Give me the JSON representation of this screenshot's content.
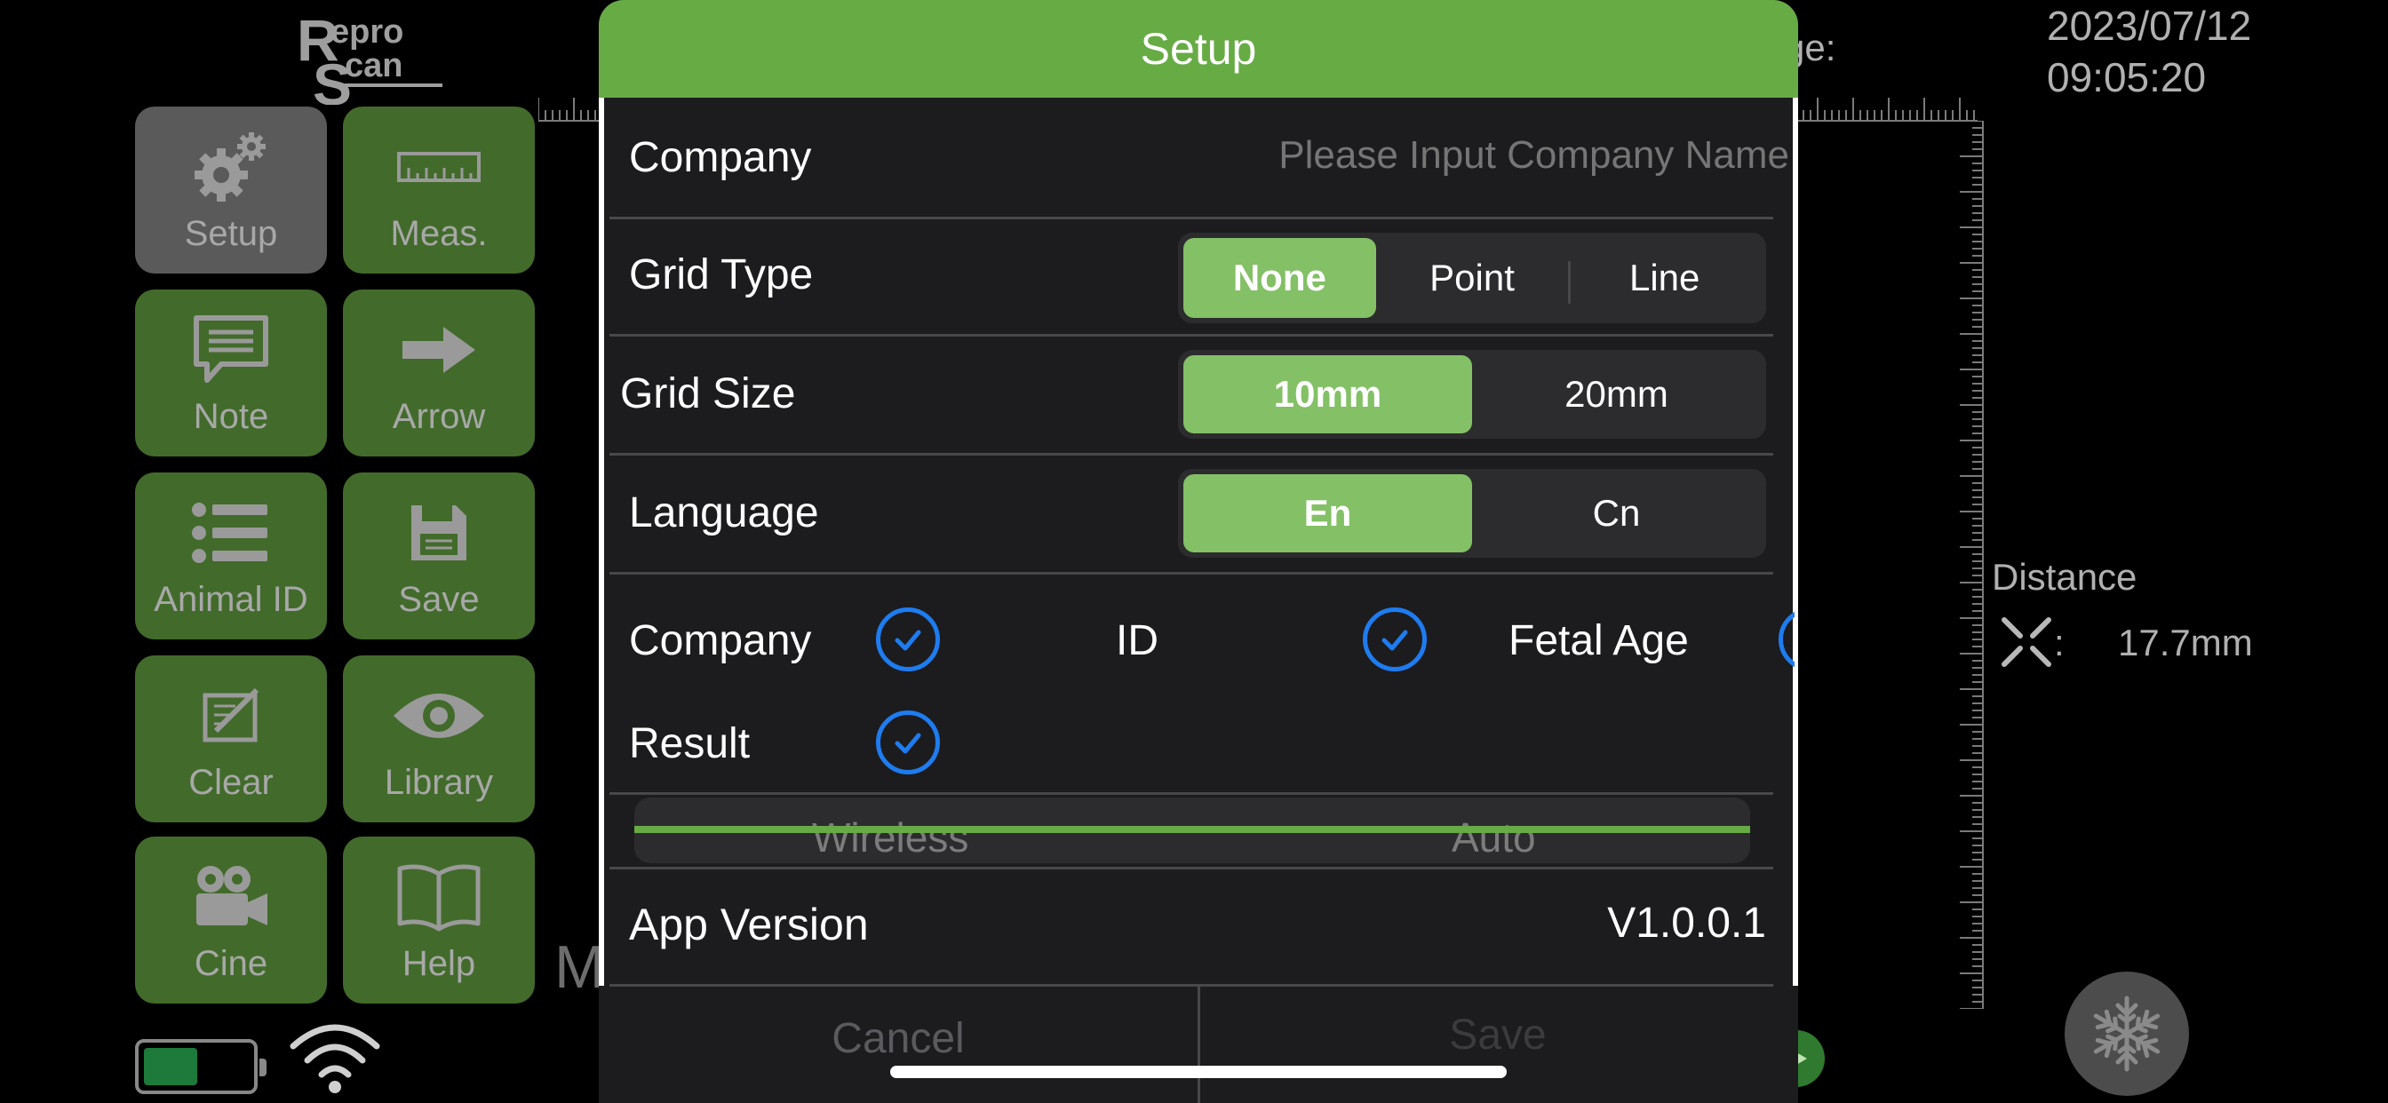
{
  "brand": {
    "logo_text": "ReproScan"
  },
  "tools": [
    {
      "label": "Setup",
      "icon": "gears-icon",
      "active": true
    },
    {
      "label": "Meas.",
      "icon": "ruler-icon"
    },
    {
      "label": "Note",
      "icon": "note-bubble-icon"
    },
    {
      "label": "Arrow",
      "icon": "arrow-right-icon"
    },
    {
      "label": "Animal ID",
      "icon": "list-icon"
    },
    {
      "label": "Save",
      "icon": "floppy-disk-icon"
    },
    {
      "label": "Clear",
      "icon": "eraser-icon"
    },
    {
      "label": "Library",
      "icon": "eye-icon"
    },
    {
      "label": "Cine",
      "icon": "video-camera-icon"
    },
    {
      "label": "Help",
      "icon": "book-icon"
    }
  ],
  "status": {
    "battery_level": 0.5,
    "wifi": "wifi-icon"
  },
  "header": {
    "date": "2023/07/12",
    "time": "09:05:20",
    "age_fragment": "ge:"
  },
  "measurement": {
    "label": "Distance",
    "colon": ":",
    "value": "17.7mm"
  },
  "background_fragment": "M",
  "dialog": {
    "title": "Setup",
    "company": {
      "label": "Company",
      "placeholder": "Please Input Company Name",
      "value": ""
    },
    "grid_type": {
      "label": "Grid Type",
      "options": [
        "None",
        "Point",
        "Line"
      ],
      "selected": "None"
    },
    "grid_size": {
      "label": "Grid Size",
      "options": [
        "10mm",
        "20mm"
      ],
      "selected": "10mm"
    },
    "language": {
      "label": "Language",
      "options": [
        "En",
        "Cn"
      ],
      "selected": "En"
    },
    "display_items": [
      {
        "label": "Company",
        "checked": true
      },
      {
        "label": "ID",
        "checked": true
      },
      {
        "label": "Fetal Age",
        "checked": true
      },
      {
        "label": "Result",
        "checked": true
      }
    ],
    "connection": {
      "left": "Wireless",
      "right": "Auto"
    },
    "app_version": {
      "label": "App Version",
      "value": "V1.0.0.1"
    },
    "buttons": {
      "cancel": "Cancel",
      "save": "Save"
    }
  },
  "colors": {
    "accent_green": "#67ab45",
    "selected_green": "#83c066",
    "tool_green": "#426b2b",
    "check_blue": "#1e7cf0"
  }
}
